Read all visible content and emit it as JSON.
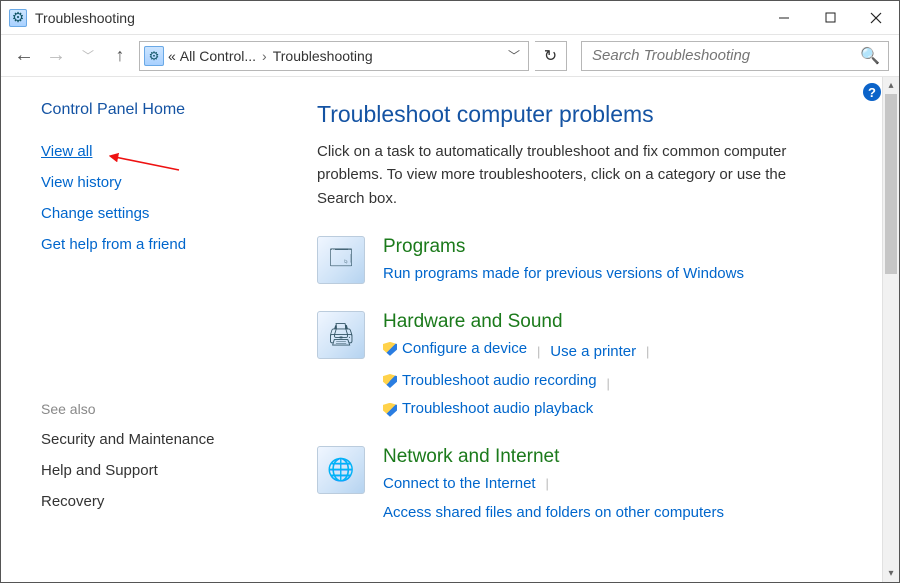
{
  "window": {
    "title": "Troubleshooting"
  },
  "breadcrumb": {
    "prefix": "«",
    "item1": "All Control...",
    "item2": "Troubleshooting"
  },
  "search": {
    "placeholder": "Search Troubleshooting"
  },
  "sidebar": {
    "home": "Control Panel Home",
    "links": {
      "view_all": "View all",
      "view_history": "View history",
      "change_settings": "Change settings",
      "get_help": "Get help from a friend"
    },
    "see_also_label": "See also",
    "see_also": {
      "security": "Security and Maintenance",
      "help": "Help and Support",
      "recovery": "Recovery"
    }
  },
  "main": {
    "heading": "Troubleshoot computer problems",
    "intro": "Click on a task to automatically troubleshoot and fix common computer problems. To view more troubleshooters, click on a category or use the Search box.",
    "categories": {
      "programs": {
        "title": "Programs",
        "link1": "Run programs made for previous versions of Windows"
      },
      "hardware": {
        "title": "Hardware and Sound",
        "link1": "Configure a device",
        "link2": "Use a printer",
        "link3": "Troubleshoot audio recording",
        "link4": "Troubleshoot audio playback"
      },
      "network": {
        "title": "Network and Internet",
        "link1": "Connect to the Internet",
        "link2": "Access shared files and folders on other computers"
      }
    }
  }
}
